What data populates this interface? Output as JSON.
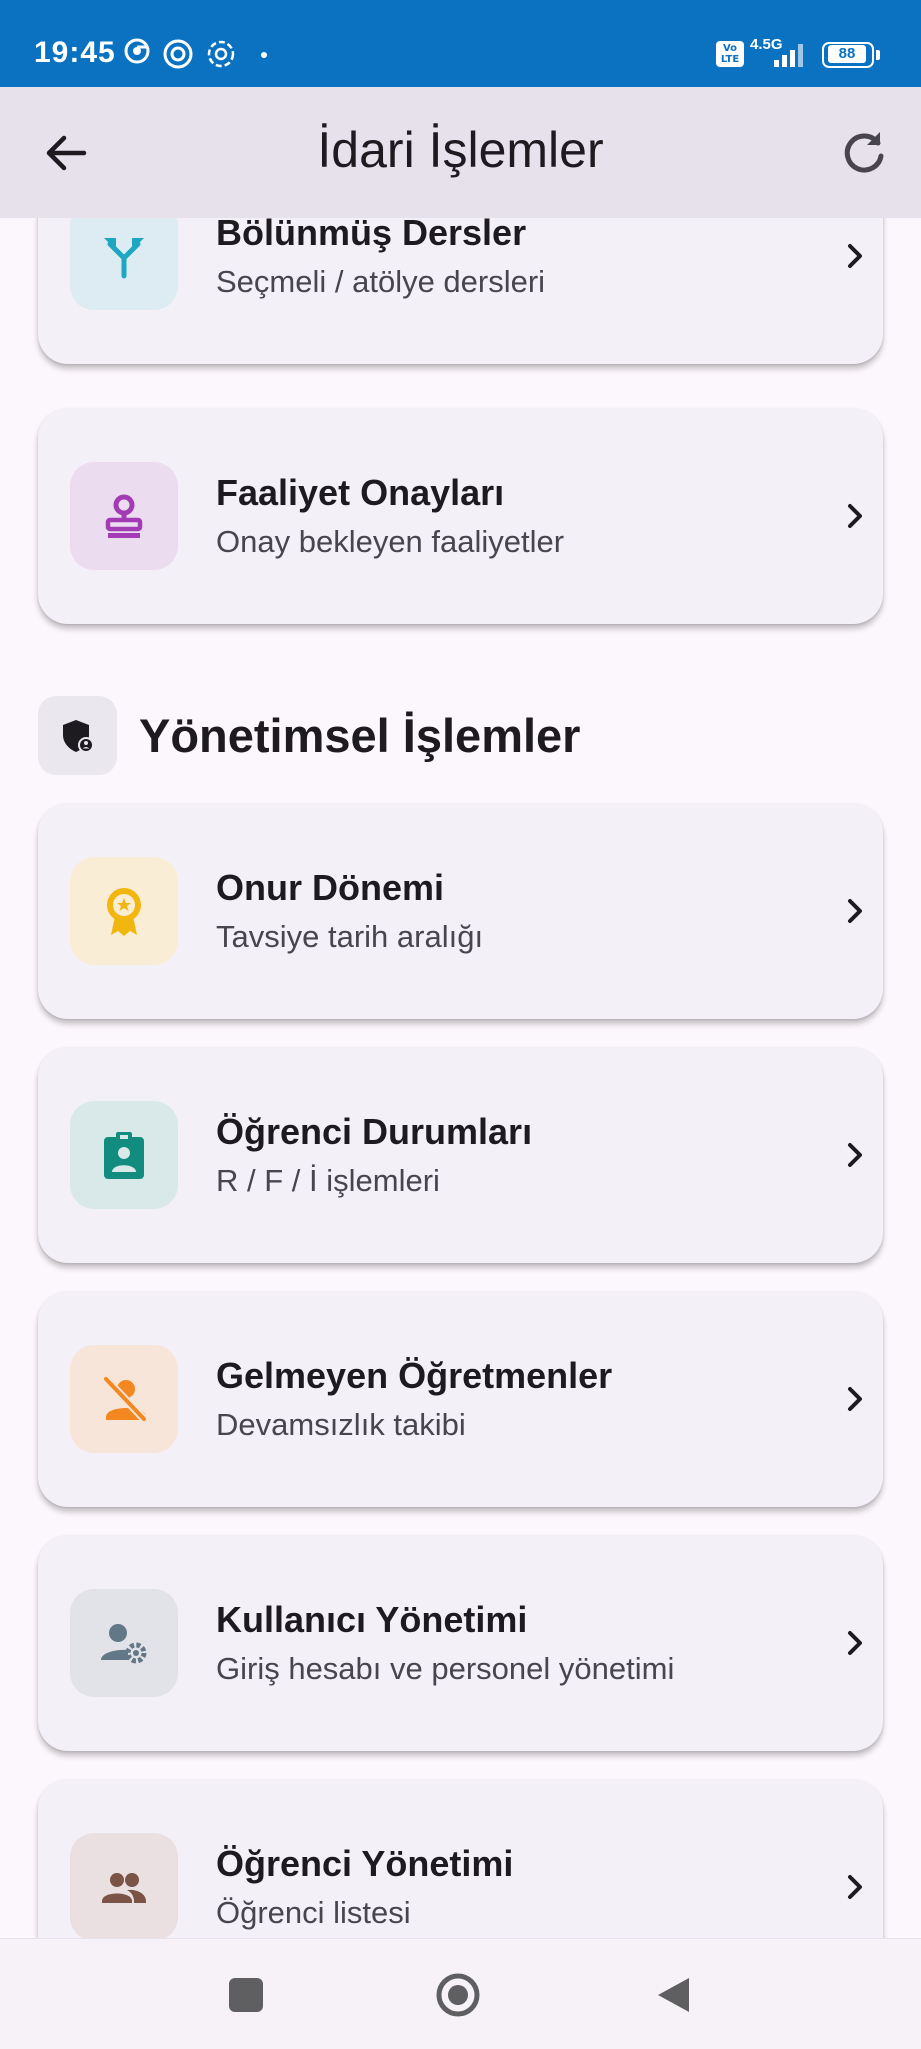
{
  "status_bar": {
    "time": "19:45",
    "network": "4.5G",
    "volte": "Vo LTE",
    "battery": "88",
    "icons": [
      "chrome-icon",
      "threads-icon",
      "openai-icon"
    ]
  },
  "app_bar": {
    "title": "İdari İşlemler",
    "back_icon": "arrow-back-icon",
    "refresh_icon": "refresh-icon"
  },
  "cards_top": [
    {
      "title": "Bölünmüş Dersler",
      "subtitle": "Seçmeli / atölye dersleri",
      "icon": "split-arrow-icon",
      "icon_color": "#1ea7c0",
      "icon_bg": "#dcecf2"
    },
    {
      "title": "Faaliyet Onayları",
      "subtitle": "Onay bekleyen faaliyetler",
      "icon": "approval-stamp-icon",
      "icon_color": "#a33bb5",
      "icon_bg": "#ecdcef"
    }
  ],
  "section": {
    "title": "Yönetimsel İşlemler",
    "icon": "admin-shield-icon"
  },
  "cards_admin": [
    {
      "title": "Onur Dönemi",
      "subtitle": "Tavsiye tarih aralığı",
      "icon": "award-badge-icon",
      "icon_color": "#f1b710",
      "icon_bg": "#f9edd6"
    },
    {
      "title": "Öğrenci Durumları",
      "subtitle": "R / F / İ işlemleri",
      "icon": "id-badge-icon",
      "icon_color": "#138c80",
      "icon_bg": "#d9e9ea"
    },
    {
      "title": "Gelmeyen Öğretmenler",
      "subtitle": "Devamsızlık takibi",
      "icon": "person-off-icon",
      "icon_color": "#f2881f",
      "icon_bg": "#f8e5da"
    },
    {
      "title": "Kullanıcı Yönetimi",
      "subtitle": "Giriş hesabı ve personel yönetimi",
      "icon": "manage-accounts-icon",
      "icon_color": "#627886",
      "icon_bg": "#e2e2e9"
    },
    {
      "title": "Öğrenci Yönetimi",
      "subtitle": "Öğrenci listesi",
      "icon": "people-icon",
      "icon_color": "#7b5447",
      "icon_bg": "#eae0e2"
    }
  ],
  "nav_bar": {
    "buttons": [
      "recent-apps-icon",
      "home-icon",
      "back-triangle-icon"
    ]
  }
}
